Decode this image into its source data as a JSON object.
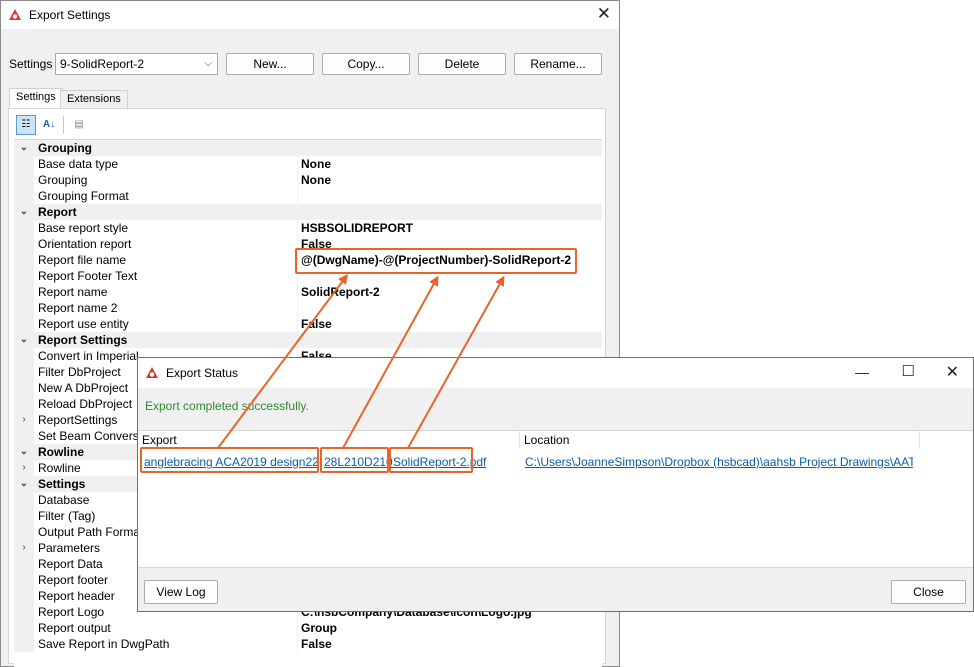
{
  "settings_window": {
    "title": "Export Settings",
    "settings_label": "Settings",
    "settings_value": "9-SolidReport-2",
    "buttons": {
      "new": "New...",
      "copy": "Copy...",
      "delete": "Delete",
      "rename": "Rename..."
    },
    "tabs": [
      "Settings",
      "Extensions"
    ],
    "toolbar_icons": [
      "categorized-icon",
      "alphabetical-icon",
      "property-pages-icon"
    ]
  },
  "property_grid": [
    {
      "type": "cat",
      "name": "Grouping",
      "expander": "expanded"
    },
    {
      "type": "prop",
      "name": "Base data type",
      "value": "None"
    },
    {
      "type": "prop",
      "name": "Grouping",
      "value": "None"
    },
    {
      "type": "prop",
      "name": "Grouping Format",
      "value": ""
    },
    {
      "type": "cat",
      "name": "Report",
      "expander": "expanded"
    },
    {
      "type": "prop",
      "name": "Base report style",
      "value": "HSBSOLIDREPORT"
    },
    {
      "type": "prop",
      "name": "Orientation report",
      "value": "False"
    },
    {
      "type": "prop",
      "name": "Report file name",
      "value": "@(DwgName)-@(ProjectNumber)-SolidReport-2"
    },
    {
      "type": "prop",
      "name": "Report Footer Text",
      "value": ""
    },
    {
      "type": "prop",
      "name": "Report name",
      "value": "SolidReport-2"
    },
    {
      "type": "prop",
      "name": "Report name 2",
      "value": ""
    },
    {
      "type": "prop",
      "name": "Report use entity",
      "value": "False"
    },
    {
      "type": "cat",
      "name": "Report Settings",
      "expander": "expanded"
    },
    {
      "type": "prop",
      "name": "Convert in Imperial",
      "value": "False"
    },
    {
      "type": "prop",
      "name": "Filter DbProject",
      "value": ""
    },
    {
      "type": "prop",
      "name": "New A DbProject",
      "value": ""
    },
    {
      "type": "prop",
      "name": "Reload DbProject",
      "value": ""
    },
    {
      "type": "prop",
      "name": "ReportSettings",
      "value": "",
      "expander": "collapsed"
    },
    {
      "type": "prop",
      "name": "Set Beam Conversion",
      "value": ""
    },
    {
      "type": "cat",
      "name": "Rowline",
      "expander": "expanded"
    },
    {
      "type": "prop",
      "name": "Rowline",
      "value": "",
      "expander": "collapsed"
    },
    {
      "type": "cat",
      "name": "Settings",
      "expander": "expanded"
    },
    {
      "type": "prop",
      "name": "Database",
      "value": ""
    },
    {
      "type": "prop",
      "name": "Filter (Tag)",
      "value": ""
    },
    {
      "type": "prop",
      "name": "Output Path Format",
      "value": ""
    },
    {
      "type": "prop",
      "name": "Parameters",
      "value": "",
      "expander": "collapsed"
    },
    {
      "type": "prop",
      "name": "Report Data",
      "value": ""
    },
    {
      "type": "prop",
      "name": "Report footer",
      "value": ""
    },
    {
      "type": "prop",
      "name": "Report header",
      "value": ""
    },
    {
      "type": "prop",
      "name": "Report Logo",
      "value": "C:\\hsbCompany\\Database\\icon\\Logo.jpg"
    },
    {
      "type": "prop",
      "name": "Report output",
      "value": "Group"
    },
    {
      "type": "prop",
      "name": "Save Report in DwgPath",
      "value": "False"
    }
  ],
  "status_window": {
    "title": "Export Status",
    "message": "Export completed successfully.",
    "columns": [
      "Export",
      "Location"
    ],
    "export_part1": "anglebracing ACA2019 design22",
    "export_part2": "28L210D210",
    "export_part3": "SolidReport-2.pdf",
    "location": "C:\\Users\\JoanneSimpson\\Dropbox (hsbcad)\\aahsb Project Drawings\\AATe",
    "view_log": "View Log",
    "close": "Close"
  },
  "colors": {
    "annotation": "#e8652a",
    "success": "#2e8b2e",
    "link": "#0b5ea8"
  }
}
